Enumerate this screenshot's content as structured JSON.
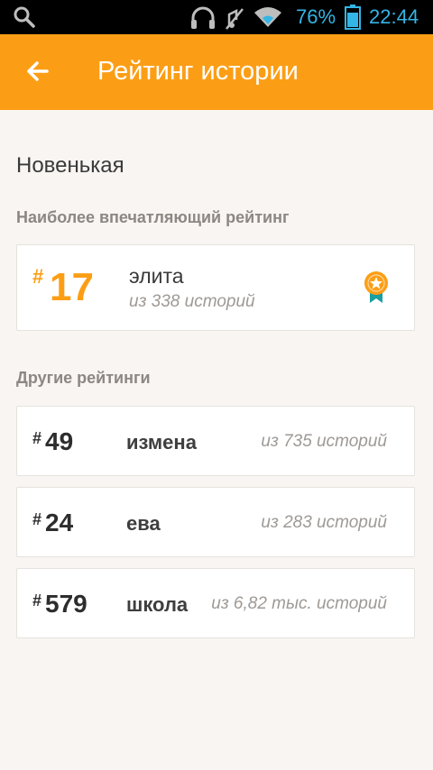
{
  "status_bar": {
    "battery_percent": "76%",
    "time": "22:44",
    "icons": [
      "search-icon",
      "headset-icon",
      "muted-icon",
      "wifi-icon",
      "battery-icon"
    ]
  },
  "app_bar": {
    "title": "Рейтинг истории",
    "back_icon": "arrow-left-icon",
    "color": "#fc9e15"
  },
  "profile": {
    "name": "Новенькая"
  },
  "top_section": {
    "label": "Наиболее впечатляющий рейтинг",
    "hash": "#",
    "rank": "17",
    "category": "элита",
    "of_text": "из 338 историй",
    "badge_icon": "award-ribbon-icon"
  },
  "other_section": {
    "label": "Другие рейтинги",
    "items": [
      {
        "hash": "#",
        "rank": "49",
        "category": "измена",
        "of_text": "из 735 историй"
      },
      {
        "hash": "#",
        "rank": "24",
        "category": "ева",
        "of_text": "из 283 историй"
      },
      {
        "hash": "#",
        "rank": "579",
        "category": "школа",
        "of_text": "из 6,82 тыс. историй"
      }
    ]
  },
  "colors": {
    "accent": "#fc9e15",
    "status_blue": "#33b5e5",
    "teal": "#1a9fa0"
  }
}
